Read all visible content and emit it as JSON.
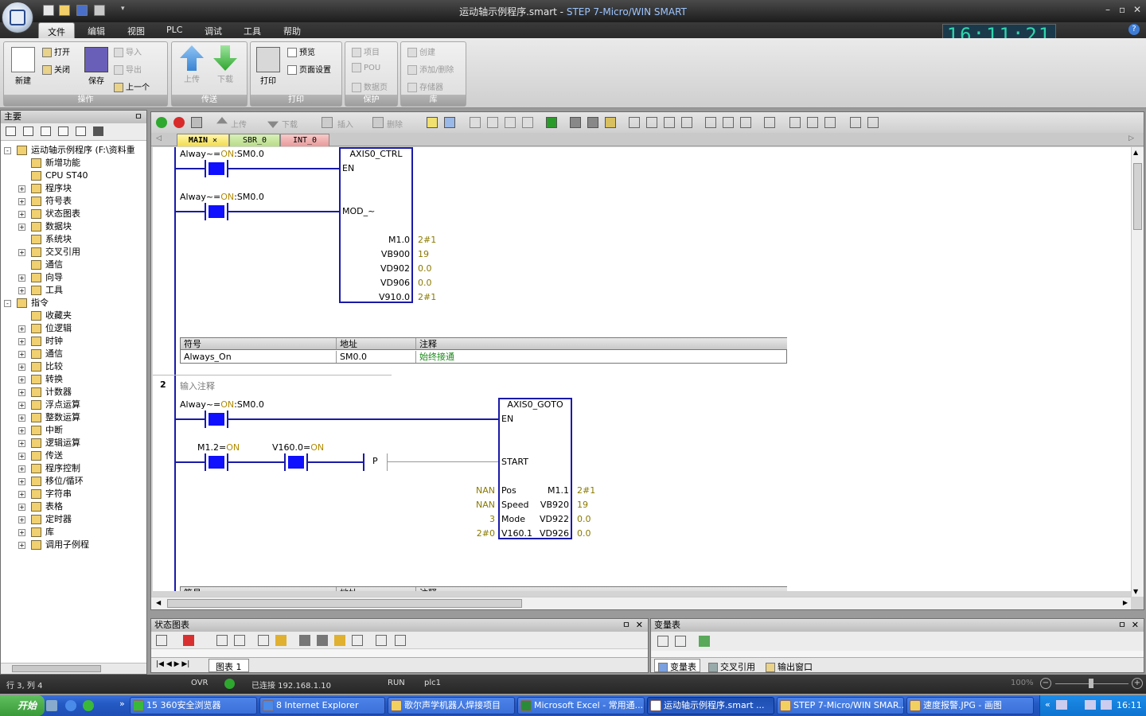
{
  "window": {
    "title_file": "运动轴示例程序.smart",
    "title_sep": " - ",
    "title_app": "STEP 7-Micro/WIN SMART",
    "min": "–",
    "max": "▫",
    "close": "✕"
  },
  "menu": {
    "file": "文件",
    "edit": "编辑",
    "view": "视图",
    "plc": "PLC",
    "debug": "调试",
    "tools": "工具",
    "help": "帮助"
  },
  "clock": "16:11:21",
  "ribbon": {
    "ops": {
      "label": "操作",
      "new": "新建",
      "open": "打开",
      "close": "关闭",
      "save": "保存",
      "import": "导入",
      "export": "导出",
      "prev": "上一个"
    },
    "transfer": {
      "label": "传送",
      "upload": "上传",
      "download": "下载"
    },
    "print": {
      "label": "打印",
      "print": "打印",
      "preview": "预览",
      "pagesetup": "页面设置"
    },
    "protect": {
      "label": "保护",
      "project": "项目",
      "pou": "POU",
      "datapage": "数据页"
    },
    "lib": {
      "label": "库",
      "create": "创建",
      "adddel": "添加/删除",
      "memory": "存储器"
    }
  },
  "leftpanel": {
    "title": "主要",
    "pin": "ㅁ",
    "items": [
      {
        "label": "运动轴示例程序 (F:\\资料重",
        "level": 0,
        "exp": "-"
      },
      {
        "label": "新增功能",
        "level": 1,
        "exp": ""
      },
      {
        "label": "CPU ST40",
        "level": 1,
        "exp": ""
      },
      {
        "label": "程序块",
        "level": 1,
        "exp": "+"
      },
      {
        "label": "符号表",
        "level": 1,
        "exp": "+"
      },
      {
        "label": "状态图表",
        "level": 1,
        "exp": "+"
      },
      {
        "label": "数据块",
        "level": 1,
        "exp": "+"
      },
      {
        "label": "系统块",
        "level": 1,
        "exp": ""
      },
      {
        "label": "交叉引用",
        "level": 1,
        "exp": "+"
      },
      {
        "label": "通信",
        "level": 1,
        "exp": ""
      },
      {
        "label": "向导",
        "level": 1,
        "exp": "+"
      },
      {
        "label": "工具",
        "level": 1,
        "exp": "+"
      },
      {
        "label": "指令",
        "level": 0,
        "exp": "-"
      },
      {
        "label": "收藏夹",
        "level": 1,
        "exp": ""
      },
      {
        "label": "位逻辑",
        "level": 1,
        "exp": "+"
      },
      {
        "label": "时钟",
        "level": 1,
        "exp": "+"
      },
      {
        "label": "通信",
        "level": 1,
        "exp": "+"
      },
      {
        "label": "比较",
        "level": 1,
        "exp": "+"
      },
      {
        "label": "转换",
        "level": 1,
        "exp": "+"
      },
      {
        "label": "计数器",
        "level": 1,
        "exp": "+"
      },
      {
        "label": "浮点运算",
        "level": 1,
        "exp": "+"
      },
      {
        "label": "整数运算",
        "level": 1,
        "exp": "+"
      },
      {
        "label": "中断",
        "level": 1,
        "exp": "+"
      },
      {
        "label": "逻辑运算",
        "level": 1,
        "exp": "+"
      },
      {
        "label": "传送",
        "level": 1,
        "exp": "+"
      },
      {
        "label": "程序控制",
        "level": 1,
        "exp": "+"
      },
      {
        "label": "移位/循环",
        "level": 1,
        "exp": "+"
      },
      {
        "label": "字符串",
        "level": 1,
        "exp": "+"
      },
      {
        "label": "表格",
        "level": 1,
        "exp": "+"
      },
      {
        "label": "定时器",
        "level": 1,
        "exp": "+"
      },
      {
        "label": "库",
        "level": 1,
        "exp": "+"
      },
      {
        "label": "调用子例程",
        "level": 1,
        "exp": "+"
      }
    ]
  },
  "editor": {
    "toolbar": {
      "upload": "上传",
      "download": "下载",
      "insert": "插入",
      "delete": "删除"
    },
    "tabs": [
      "MAIN",
      "SBR_0",
      "INT_0"
    ],
    "tab_close": "✕",
    "net1": {
      "c1_label_a": "Alway~=",
      "c1_label_on": "ON",
      "c1_label_b": ":SM0.0",
      "c2_label_a": "Alway~=",
      "c2_label_on": "ON",
      "c2_label_b": ":SM0.0",
      "box_title": "AXIS0_CTRL",
      "in_en": "EN",
      "in_mod": "MOD_~",
      "outs": [
        {
          "pin": "M1.0",
          "val": "2#1"
        },
        {
          "pin": "VB900",
          "val": "19"
        },
        {
          "pin": "VD902",
          "val": "0.0"
        },
        {
          "pin": "VD906",
          "val": "0.0"
        },
        {
          "pin": "V910.0",
          "val": "2#1"
        }
      ],
      "sym_headers": [
        "符号",
        "地址",
        "注释"
      ],
      "sym_row": [
        "Always_On",
        "SM0.0",
        "始终接通"
      ]
    },
    "net2": {
      "number": "2",
      "comment": "输入注释",
      "c1_label_a": "Alway~=",
      "c1_label_on": "ON",
      "c1_label_b": ":SM0.0",
      "c2_label_a": "M1.2=",
      "c2_label_on": "ON",
      "c3_label_a": "V160.0=",
      "c3_label_on": "ON",
      "p_label": "P",
      "box_title": "AXIS0_GOTO",
      "in_en": "EN",
      "in_start": "START",
      "ins": [
        {
          "val": "NAN",
          "pin": "Pos"
        },
        {
          "val": "NAN",
          "pin": "Speed"
        },
        {
          "val": "3",
          "pin": "Mode"
        },
        {
          "val": "2#0",
          "pin": "V160.1"
        }
      ],
      "outs": [
        {
          "pin": "M1.1",
          "val": "2#1"
        },
        {
          "pin": "VB920",
          "val": "19"
        },
        {
          "pin": "VD922",
          "val": "0.0"
        },
        {
          "pin": "VD926",
          "val": "0.0"
        }
      ],
      "sym_headers": [
        "符号",
        "地址",
        "注释"
      ]
    }
  },
  "status_chart": {
    "title": "状态图表",
    "pin": "ㅁ",
    "close": "✕",
    "tab": "图表 1"
  },
  "var_table": {
    "title": "变量表",
    "pin": "ㅁ",
    "close": "✕",
    "tabs": [
      "变量表",
      "交叉引用",
      "输出窗口"
    ]
  },
  "statusbar": {
    "pos": "行 3, 列 4",
    "ovr": "OVR",
    "conn": "已连接 192.168.1.10",
    "run": "RUN",
    "plc": "plc1",
    "zoom": "100%"
  },
  "taskbar": {
    "start": "开始",
    "items": [
      "15 360安全浏览器",
      "8 Internet Explorer",
      "歌尔声学机器人焊接项目",
      "Microsoft Excel - 常用通...",
      "运动轴示例程序.smart ...",
      "STEP 7-Micro/WIN SMAR...",
      "速度报警.JPG - 画图"
    ],
    "time": "16:11"
  }
}
